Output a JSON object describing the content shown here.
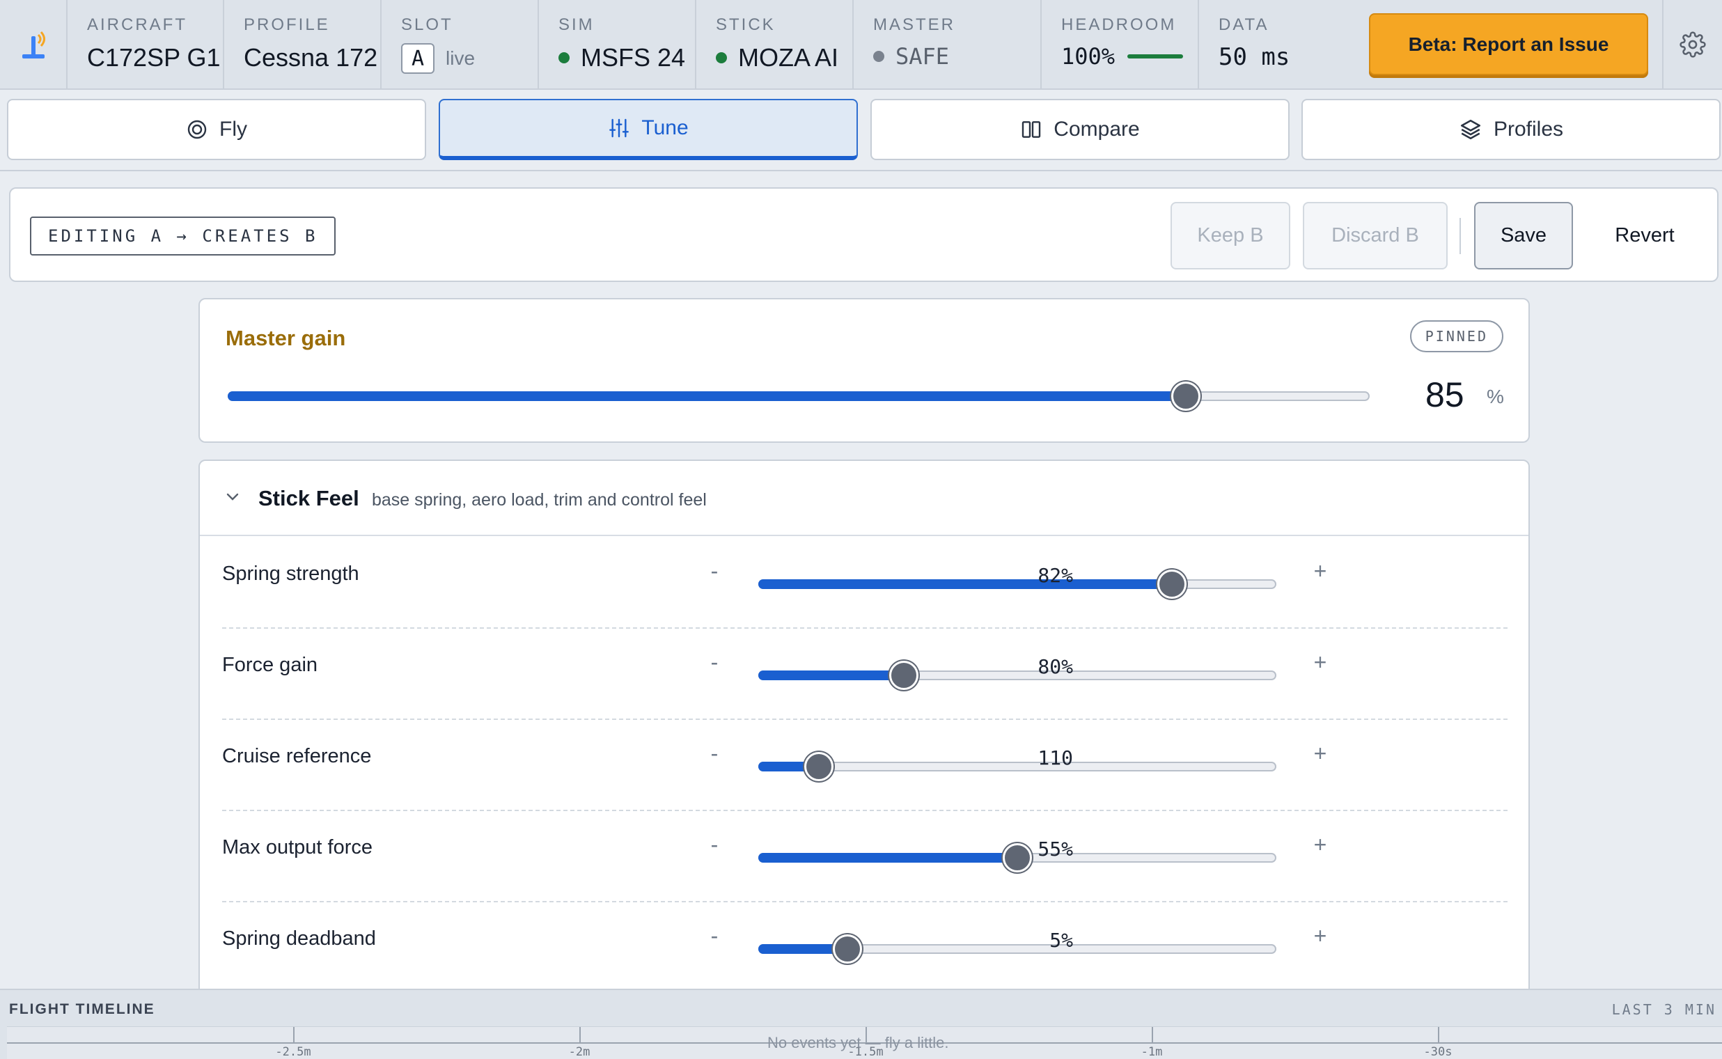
{
  "status": {
    "aircraft": {
      "label": "AIRCRAFT",
      "value": "C172SP G1"
    },
    "profile": {
      "label": "PROFILE",
      "value": "Cessna 172"
    },
    "slot": {
      "label": "SLOT",
      "value": "A",
      "state": "live"
    },
    "sim": {
      "label": "SIM",
      "value": "MSFS 24",
      "status_color": "#1c7d3d"
    },
    "stick": {
      "label": "STICK",
      "value": "MOZA AI",
      "status_color": "#1c7d3d"
    },
    "master": {
      "label": "MASTER",
      "value": "SAFE",
      "status_color": "#7a828e"
    },
    "headroom": {
      "label": "HEADROOM",
      "value": "100%",
      "level": 1.0
    },
    "data": {
      "label": "DATA",
      "value": "50 ms"
    },
    "report_button": "Beta: Report an Issue"
  },
  "tabs": [
    {
      "label": "Fly",
      "icon": "target-icon",
      "active": false
    },
    {
      "label": "Tune",
      "icon": "sliders-icon",
      "active": true
    },
    {
      "label": "Compare",
      "icon": "columns-icon",
      "active": false
    },
    {
      "label": "Profiles",
      "icon": "layers-icon",
      "active": false
    }
  ],
  "toolbar": {
    "editing": "EDITING A → CREATES B",
    "keep": "Keep B",
    "discard": "Discard B",
    "save": "Save",
    "revert": "Revert"
  },
  "master_gain": {
    "title": "Master gain",
    "badge": "PINNED",
    "value": "85",
    "unit": "%",
    "level": 0.84
  },
  "stick_feel": {
    "title": "Stick Feel",
    "subtitle": "base spring, aero load, trim and control feel",
    "rows": [
      {
        "label": "Spring strength",
        "value": "82%",
        "level": 0.8
      },
      {
        "label": "Force gain",
        "value": "80%",
        "level": 0.28
      },
      {
        "label": "Cruise reference",
        "value": "110",
        "level": 0.115
      },
      {
        "label": "Max output force",
        "value": "55%",
        "level": 0.5
      },
      {
        "label": "Spring deadband",
        "value": "5%",
        "level": 0.17
      }
    ],
    "minus": "-",
    "plus": "+"
  },
  "timeline": {
    "title": "FLIGHT TIMELINE",
    "range": "LAST 3 MIN",
    "empty": "No events yet — fly a little.",
    "ticks": [
      "-2.5m",
      "-2m",
      "-1.5m",
      "-1m",
      "-30s"
    ]
  },
  "colors": {
    "accent": "#1a5fd0",
    "report": "#f5a623",
    "master_title": "#9a6d0a"
  }
}
